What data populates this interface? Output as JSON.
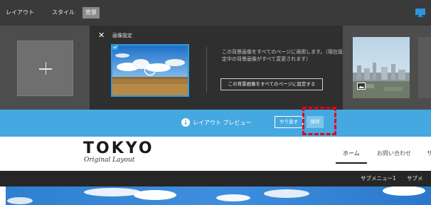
{
  "toolbar": {
    "tabs": [
      {
        "label": "レイアウト"
      },
      {
        "label": "スタイル"
      },
      {
        "label": "背景"
      }
    ],
    "device_icon": "monitor-icon"
  },
  "background_dialog": {
    "close_glyph": "✕",
    "title": "画像設定",
    "description": "この背景画像をすべてのページに適用します。（現在設定中の背景画像がすべて変更されます）",
    "apply_all_label": "この背景画像をすべてのページに設定する"
  },
  "preview_bar": {
    "label": "レイアウト プレビュー",
    "redo_label": "やり直す",
    "save_label": "保存"
  },
  "site": {
    "logo_title": "TOKYO",
    "logo_subtitle": "Original Layout",
    "nav": [
      {
        "label": "ホーム"
      },
      {
        "label": "お問い合わせ"
      },
      {
        "label": "サ"
      }
    ],
    "submenu": [
      {
        "label": "サブメニュー1"
      },
      {
        "label": "サブメ"
      }
    ]
  },
  "colors": {
    "accent_blue": "#45a8e0",
    "highlight_red": "#e60012",
    "selected_border": "#2f9be0"
  }
}
